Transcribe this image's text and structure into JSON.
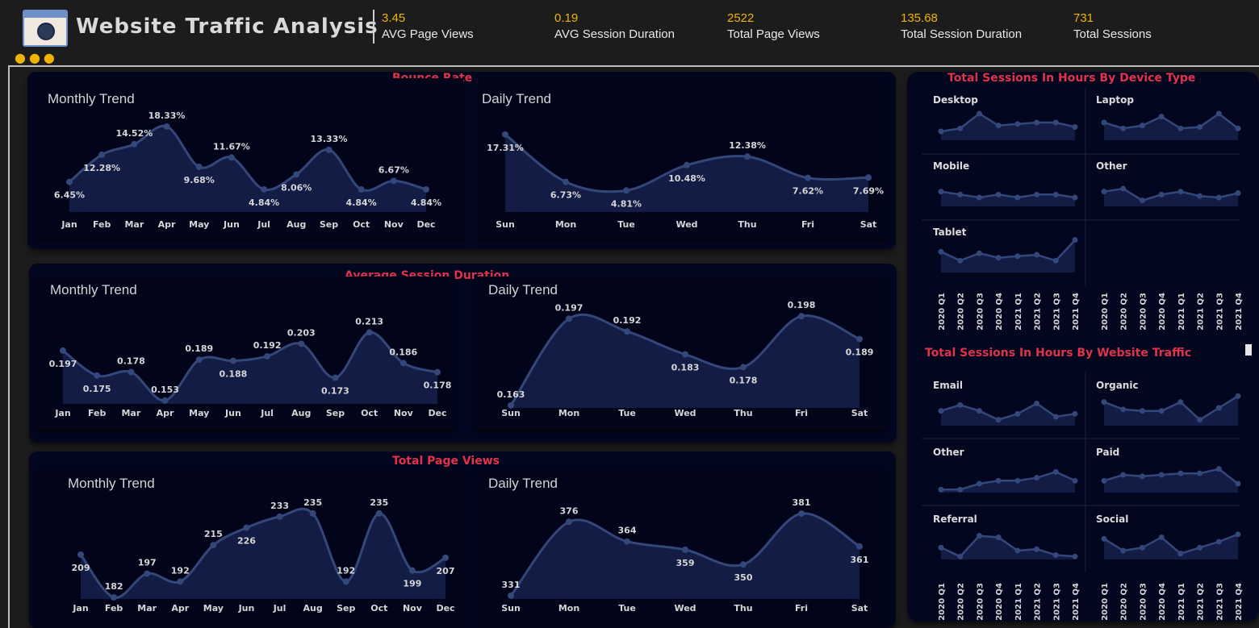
{
  "header": {
    "title": "Website Traffic Analysis",
    "kpis": [
      {
        "value": "3.45",
        "label": "AVG Page Views"
      },
      {
        "value": "0.19",
        "label": "AVG Session Duration"
      },
      {
        "value": "2522",
        "label": "Total Page Views"
      },
      {
        "value": "135.68",
        "label": "Total Session Duration"
      },
      {
        "value": "731",
        "label": "Total Sessions"
      }
    ]
  },
  "colors": {
    "accent": "#f0b400",
    "title_red": "#e0334a",
    "line": "#34477a",
    "area": "#121c44",
    "panel": "#03061f"
  },
  "icons": [
    "browser-globe-icon",
    "people-icon"
  ],
  "sections": {
    "bounce": {
      "title": "Bounce Rate",
      "monthly_title": "Monthly Trend",
      "daily_title": "Daily Trend"
    },
    "duration": {
      "title": "Average Session Duration",
      "monthly_title": "Monthly Trend",
      "daily_title": "Daily Trend"
    },
    "pageviews": {
      "title": "Total Page Views",
      "monthly_title": "Monthly Trend",
      "daily_title": "Daily Trend"
    },
    "device": {
      "title": "Total Sessions In Hours By Device Type"
    },
    "traffic": {
      "title": "Total Sessions In Hours By Website Traffic"
    }
  },
  "chart_data": [
    {
      "id": "bounce_monthly",
      "type": "area",
      "title": "Monthly Trend",
      "categories": [
        "Jan",
        "Feb",
        "Mar",
        "Apr",
        "May",
        "Jun",
        "Jul",
        "Aug",
        "Sep",
        "Oct",
        "Nov",
        "Dec"
      ],
      "values": [
        6.45,
        12.28,
        14.52,
        18.33,
        9.68,
        11.67,
        4.84,
        8.06,
        13.33,
        4.84,
        6.67,
        4.84
      ],
      "labels": [
        "6.45%",
        "12.28%",
        "14.52%",
        "18.33%",
        "9.68%",
        "11.67%",
        "4.84%",
        "8.06%",
        "13.33%",
        "4.84%",
        "6.67%",
        "4.84%"
      ],
      "ylim": [
        0,
        19
      ]
    },
    {
      "id": "bounce_daily",
      "type": "area",
      "title": "Daily Trend",
      "categories": [
        "Sun",
        "Mon",
        "Tue",
        "Wed",
        "Thu",
        "Fri",
        "Sat"
      ],
      "values": [
        17.31,
        6.73,
        4.81,
        10.48,
        12.38,
        7.62,
        7.69
      ],
      "labels": [
        "17.31%",
        "6.73%",
        "4.81%",
        "10.48%",
        "12.38%",
        "7.62%",
        "7.69%"
      ],
      "ylim": [
        0,
        18
      ]
    },
    {
      "id": "duration_monthly",
      "type": "area",
      "title": "Monthly Trend",
      "categories": [
        "Jan",
        "Feb",
        "Mar",
        "Apr",
        "May",
        "Jun",
        "Jul",
        "Aug",
        "Sep",
        "Oct",
        "Nov",
        "Dec"
      ],
      "values": [
        0.197,
        0.175,
        0.178,
        0.153,
        0.189,
        0.188,
        0.192,
        0.203,
        0.173,
        0.213,
        0.186,
        0.178
      ],
      "labels": [
        "0.197",
        "0.175",
        "0.178",
        "0.153",
        "0.189",
        "0.188",
        "0.192",
        "0.203",
        "0.173",
        "0.213",
        "0.186",
        "0.178"
      ],
      "ylim": [
        0.15,
        0.214
      ]
    },
    {
      "id": "duration_daily",
      "type": "area",
      "title": "Daily Trend",
      "categories": [
        "Sun",
        "Mon",
        "Tue",
        "Wed",
        "Thu",
        "Fri",
        "Sat"
      ],
      "values": [
        0.163,
        0.197,
        0.192,
        0.183,
        0.178,
        0.198,
        0.189
      ],
      "labels": [
        "0.163",
        "0.197",
        "0.192",
        "0.183",
        "0.178",
        "0.198",
        "0.189"
      ],
      "ylim": [
        0.162,
        0.199
      ]
    },
    {
      "id": "pageviews_monthly",
      "type": "area",
      "title": "Monthly Trend",
      "categories": [
        "Jan",
        "Feb",
        "Mar",
        "Apr",
        "May",
        "Jun",
        "Jul",
        "Aug",
        "Sep",
        "Oct",
        "Nov",
        "Dec"
      ],
      "values": [
        209,
        182,
        197,
        192,
        215,
        226,
        233,
        235,
        192,
        235,
        199,
        207
      ],
      "labels": [
        "209",
        "182",
        "197",
        "192",
        "215",
        "226",
        "233",
        "235",
        "192",
        "235",
        "199",
        "207"
      ],
      "ylim": [
        181,
        237
      ]
    },
    {
      "id": "pageviews_daily",
      "type": "area",
      "title": "Daily Trend",
      "categories": [
        "Sun",
        "Mon",
        "Tue",
        "Wed",
        "Thu",
        "Fri",
        "Sat"
      ],
      "values": [
        331,
        376,
        364,
        359,
        350,
        381,
        361
      ],
      "labels": [
        "331",
        "376",
        "364",
        "359",
        "350",
        "381",
        "361"
      ],
      "ylim": [
        329,
        383
      ]
    },
    {
      "id": "device_small_multiples",
      "type": "line",
      "title": "Total Sessions In Hours By Device Type",
      "categories": [
        "2020 Q1",
        "2020 Q2",
        "2020 Q3",
        "2020 Q4",
        "2021 Q1",
        "2021 Q2",
        "2021 Q3",
        "2021 Q4"
      ],
      "series": [
        {
          "name": "Desktop",
          "values": [
            3,
            4,
            9,
            5,
            5.5,
            6,
            6,
            4.5
          ]
        },
        {
          "name": "Laptop",
          "values": [
            6,
            4,
            5,
            8,
            4,
            4.5,
            9,
            4
          ]
        },
        {
          "name": "Mobile",
          "values": [
            5,
            4,
            3,
            4,
            3,
            4,
            4,
            3
          ]
        },
        {
          "name": "Other",
          "values": [
            5,
            6,
            2,
            4,
            5,
            3.5,
            3,
            4.5
          ]
        },
        {
          "name": "Tablet",
          "values": [
            7,
            4,
            6.5,
            5,
            5.5,
            6,
            4,
            11
          ]
        }
      ]
    },
    {
      "id": "traffic_small_multiples",
      "type": "line",
      "title": "Total Sessions In Hours By Website Traffic",
      "categories": [
        "2020 Q1",
        "2020 Q2",
        "2020 Q3",
        "2020 Q4",
        "2021 Q1",
        "2021 Q2",
        "2021 Q3",
        "2021 Q4"
      ],
      "series": [
        {
          "name": "Email",
          "values": [
            5,
            7,
            5,
            2,
            4,
            7.5,
            3,
            4
          ]
        },
        {
          "name": "Organic",
          "values": [
            8,
            5.5,
            5,
            5,
            8,
            2,
            6,
            10
          ]
        },
        {
          "name": "Other",
          "values": [
            1,
            1,
            3,
            4,
            4,
            5,
            7,
            4
          ]
        },
        {
          "name": "Paid",
          "values": [
            4,
            6,
            5.5,
            6,
            6.5,
            6.5,
            8,
            3
          ]
        },
        {
          "name": "Referral",
          "values": [
            4,
            1,
            8,
            7.5,
            3,
            3.5,
            1.5,
            1
          ]
        },
        {
          "name": "Social",
          "values": [
            7,
            3,
            4,
            7.5,
            2,
            4,
            6,
            8.5
          ]
        }
      ]
    }
  ]
}
